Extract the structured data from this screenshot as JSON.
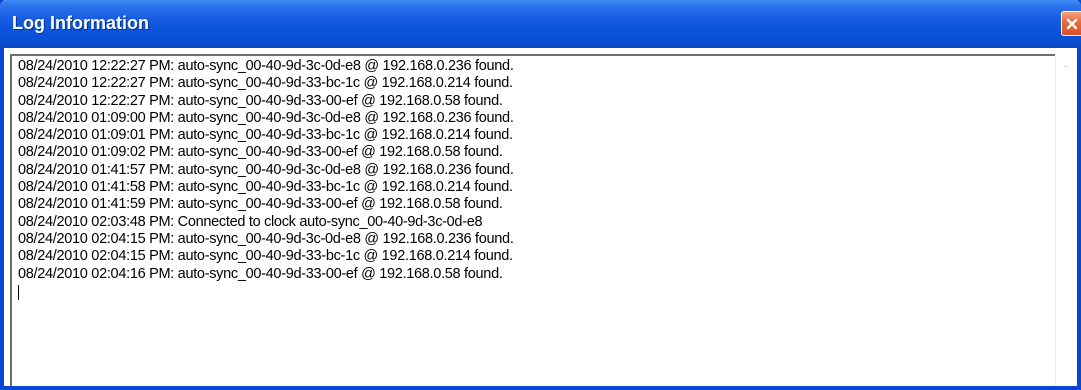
{
  "window": {
    "title": "Log Information"
  },
  "log": {
    "lines": [
      "08/24/2010 12:22:27 PM: auto-sync_00-40-9d-3c-0d-e8 @ 192.168.0.236 found.",
      "08/24/2010 12:22:27 PM: auto-sync_00-40-9d-33-bc-1c @ 192.168.0.214 found.",
      "08/24/2010 12:22:27 PM: auto-sync_00-40-9d-33-00-ef @ 192.168.0.58 found.",
      "08/24/2010 01:09:00 PM: auto-sync_00-40-9d-3c-0d-e8 @ 192.168.0.236 found.",
      "08/24/2010 01:09:01 PM: auto-sync_00-40-9d-33-bc-1c @ 192.168.0.214 found.",
      "08/24/2010 01:09:02 PM: auto-sync_00-40-9d-33-00-ef @ 192.168.0.58 found.",
      "08/24/2010 01:41:57 PM: auto-sync_00-40-9d-3c-0d-e8 @ 192.168.0.236 found.",
      "08/24/2010 01:41:58 PM: auto-sync_00-40-9d-33-bc-1c @ 192.168.0.214 found.",
      "08/24/2010 01:41:59 PM: auto-sync_00-40-9d-33-00-ef @ 192.168.0.58 found.",
      "08/24/2010 02:03:48 PM: Connected to clock auto-sync_00-40-9d-3c-0d-e8",
      "08/24/2010 02:04:15 PM: auto-sync_00-40-9d-3c-0d-e8 @ 192.168.0.236 found.",
      "08/24/2010 02:04:15 PM: auto-sync_00-40-9d-33-bc-1c @ 192.168.0.214 found.",
      "08/24/2010 02:04:16 PM: auto-sync_00-40-9d-33-00-ef @ 192.168.0.58 found."
    ]
  },
  "icons": {
    "close": "close-icon"
  },
  "colors": {
    "titlebar": "#0a4fd3",
    "close_button": "#e76a3c",
    "log_text": "#000000",
    "background": "#ffffff"
  }
}
